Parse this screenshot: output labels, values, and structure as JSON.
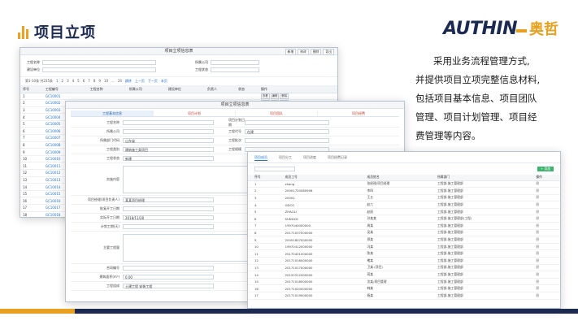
{
  "header": {
    "title": "项目立项",
    "logo_en": "AUTHINE",
    "logo_cn": "奥哲",
    "brand_navy": "#1c2a52",
    "brand_orange": "#e8a020"
  },
  "description": {
    "lines": [
      "采用业务流程管理方式,",
      "并提供项目立项完整信息材料,",
      "包括项目基本信息、项目团队",
      "管理、项目计划管理、项目经",
      "费管理等内容。"
    ]
  },
  "window1": {
    "title": "项目立项信息表",
    "buttons": [
      "新增",
      "修改",
      "删除",
      "导出"
    ],
    "filters": [
      "工程名称",
      "所属公司",
      "建设单位",
      "工程状态"
    ],
    "pager": {
      "text": "第1-10条 共235条",
      "pages": [
        "1",
        "2",
        "3",
        "4",
        "5",
        "6",
        "7",
        "8",
        "9",
        "10",
        "...",
        "24"
      ],
      "goto": "跳转",
      "prev": "上一页",
      "next": "下一页",
      "last": "末页"
    },
    "columns": [
      "序号",
      "工程编号",
      "工程名称",
      "所属公司",
      "建设单位",
      "负责人",
      "状态",
      "操作"
    ],
    "rows": [
      [
        "1",
        "GC10001"
      ],
      [
        "2",
        "GC10002"
      ],
      [
        "3",
        "GC10003"
      ],
      [
        "4",
        "GC10004"
      ],
      [
        "5",
        "GC10005"
      ],
      [
        "6",
        "GC10006"
      ],
      [
        "7",
        "GC10007"
      ],
      [
        "8",
        "GC10008"
      ],
      [
        "9",
        "GC10009"
      ],
      [
        "10",
        "GC10010"
      ],
      [
        "11",
        "GC10011"
      ],
      [
        "12",
        "GC10012"
      ],
      [
        "13",
        "GC10013"
      ],
      [
        "14",
        "GC10014"
      ],
      [
        "15",
        "GC10015"
      ],
      [
        "16",
        "GC10016"
      ],
      [
        "17",
        "GC10017"
      ],
      [
        "18",
        "GC10018"
      ],
      [
        "19",
        "GC10019"
      ]
    ],
    "row_ops": [
      "查看",
      "编辑",
      "删除"
    ]
  },
  "window2": {
    "title": "项目立项信息表",
    "tabs": [
      "工程基本信息",
      "项目计划",
      "项目团队",
      "项目经费"
    ],
    "fields_left": [
      {
        "label": "工程名称",
        "value": ""
      },
      {
        "label": "所属公司",
        "value": ""
      },
      {
        "label": "所属部门代码",
        "value": "山东省"
      },
      {
        "label": "工程类别",
        "value": "建筑施工类项目"
      },
      {
        "label": "工程状态",
        "value": "新建"
      }
    ],
    "fields_right": [
      {
        "label": "项目计划日期",
        "value": ""
      },
      {
        "label": "工程代号",
        "value": "在建"
      },
      {
        "label": "工程批次",
        "value": ""
      },
      {
        "label": "工程规模",
        "value": ""
      }
    ],
    "scope_label": "实施内容",
    "fields_lower": [
      {
        "label": "项目经理(项目负责人)",
        "value": "某某项目经理"
      },
      {
        "label": "批复开工日期",
        "value": ""
      },
      {
        "label": "实际开工日期",
        "value": "2018/11/28"
      },
      {
        "label": "计划工期(天)",
        "value": ""
      }
    ],
    "memo_label": "主要工程量",
    "fields_bottom": [
      {
        "label": "合同编号",
        "value": ""
      },
      {
        "label": "建筑面积(m²)",
        "value": "0.00"
      },
      {
        "label": "工程组成",
        "value": "土建工程  安装工程"
      }
    ]
  },
  "window3": {
    "tabs": [
      "项目成员",
      "项目分工",
      "项目进度",
      "项目经费记录"
    ],
    "add_label": "+ 添加",
    "columns": [
      "序号",
      "成员工号",
      "成员姓名",
      "所属部门",
      "操作"
    ],
    "rows": [
      [
        "1",
        "zhang",
        "张经理/项目经理",
        "工程部-施工管理部"
      ],
      [
        "2",
        "20001720080906",
        "李四",
        "工程部-施工管理部"
      ],
      [
        "3",
        "20001",
        "王五",
        "工程部-施工管理部"
      ],
      [
        "4",
        "GDCG",
        "赵六",
        "工程部-施工管理部"
      ],
      [
        "5",
        "ZHAOLI",
        "赵丽",
        "工程部-施工管理部"
      ],
      [
        "6",
        "SUNXXX",
        "孙某某",
        "工程部-施工管理部(工程)"
      ],
      [
        "7",
        "1997040000000",
        "周某",
        "工程部-施工管理部"
      ],
      [
        "8",
        "20171037000000",
        "吴某",
        "工程部-施工管理部"
      ],
      [
        "9",
        "20001807000000",
        "郑某",
        "工程部-施工管理部"
      ],
      [
        "10",
        "19970412000000",
        "冯某",
        "工程部-施工管理部"
      ],
      [
        "11",
        "20170401000000",
        "陈某",
        "工程部-施工管理部"
      ],
      [
        "12",
        "20171016000000",
        "褚某",
        "工程部-施工管理部"
      ],
      [
        "13",
        "20171017000000",
        "卫某 (项目)",
        "工程部-施工管理部"
      ],
      [
        "14",
        "20120312000000",
        "蒋某",
        "工程部-施工管理部"
      ],
      [
        "15",
        "20171018000000",
        "沈某/项目管理",
        "工程部-施工管理部"
      ],
      [
        "16",
        "20171020000000",
        "韩某",
        "工程部-施工管理部"
      ],
      [
        "17",
        "20171019000000",
        "杨某",
        "工程部-施工管理部"
      ]
    ],
    "row_op": "删"
  }
}
